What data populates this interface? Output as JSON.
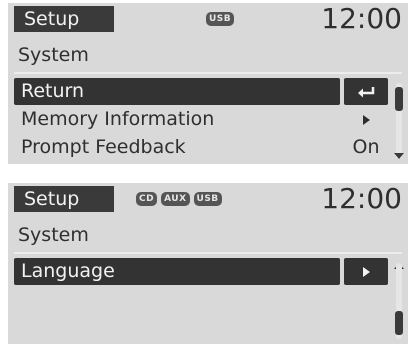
{
  "screens": [
    {
      "tab_label": "Setup",
      "badges": [
        "USB"
      ],
      "clock": "12:00",
      "section_title": "System",
      "rows": [
        {
          "label": "Return",
          "selected": true,
          "action_icon": "back-arrow-icon",
          "value": ""
        },
        {
          "label": "Memory Information",
          "selected": false,
          "action_icon": "right-arrow-icon",
          "value": ""
        },
        {
          "label": "Prompt Feedback",
          "selected": false,
          "action_icon": "",
          "value": "On"
        }
      ],
      "scroll_position": 0.0
    },
    {
      "tab_label": "Setup",
      "badges": [
        "CD",
        "AUX",
        "USB"
      ],
      "clock": "12:00",
      "section_title": "System",
      "rows": [
        {
          "label": "Language",
          "selected": true,
          "action_icon": "right-arrow-icon",
          "value": ""
        }
      ],
      "scroll_position": 1.0
    }
  ],
  "colors": {
    "screen_bg": "#d9d9d9",
    "highlight_bg": "#333333",
    "highlight_text": "#f2f2f2",
    "text": "#2f2f2f"
  }
}
